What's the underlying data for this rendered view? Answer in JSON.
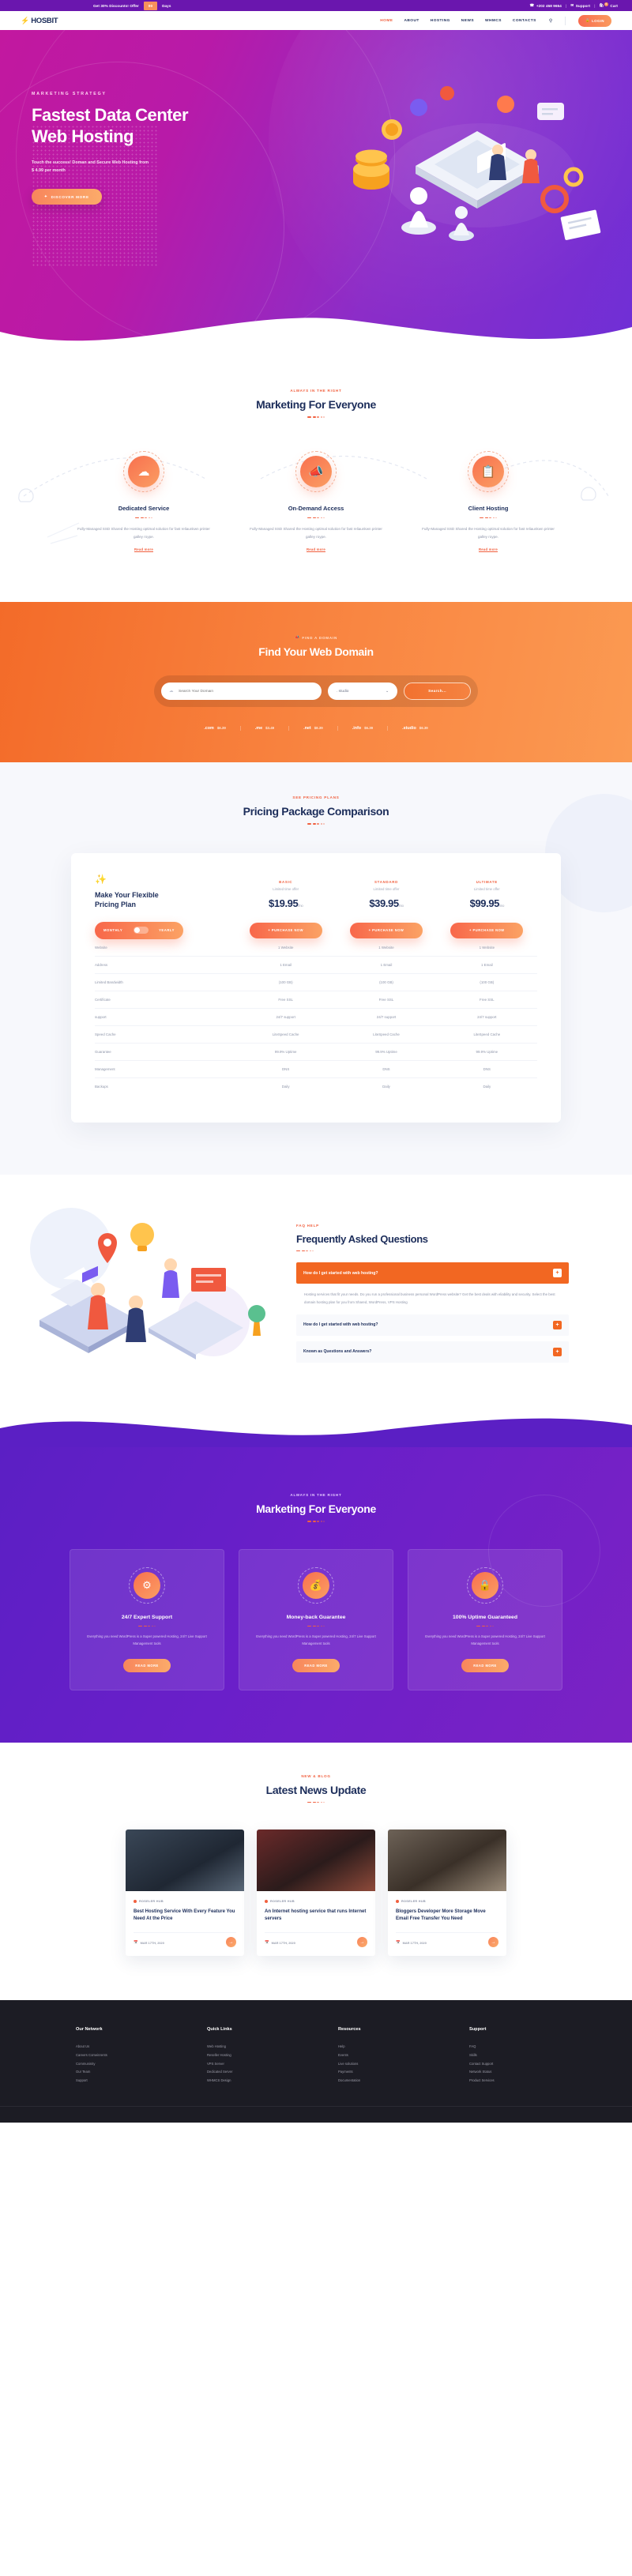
{
  "topbar": {
    "offer": "Get 30% Discounts! Offer",
    "count": "00",
    "days": "Days",
    "phone": "+202 458 9654",
    "support": "Support",
    "cart": "Cart",
    "cart_badge": "0",
    "phone_icon": "headset-icon",
    "support_icon": "envelope-icon",
    "cart_icon": "cart-icon"
  },
  "nav": {
    "logo_mark": "bolt-icon",
    "logo": "HOSBIT",
    "items": [
      {
        "label": "HOME",
        "active": true
      },
      {
        "label": "ABOUT",
        "active": false
      },
      {
        "label": "HOSTING",
        "active": false
      },
      {
        "label": "NEWS",
        "active": false
      },
      {
        "label": "WHMCS",
        "active": false
      },
      {
        "label": "CONTACTS",
        "active": false
      }
    ],
    "search_icon": "search-icon",
    "login": "LOGIN",
    "login_icon": "lock-icon"
  },
  "hero": {
    "kicker": "MARKETING STRATEGY",
    "title_line1": "Fastest Data Center",
    "title_line2": "Web Hosting",
    "sub_line1": "Touch the success! Doman and Secure Web Hosting from",
    "sub_line2": "$ 4.99 per month",
    "cta": "DISCOVER MORE",
    "cta_icon": "sparkle-icon"
  },
  "services": {
    "kicker": "ALWAYS IN THE RIGHT",
    "title": "Marketing For Everyone",
    "cards": [
      {
        "icon": "cloud-server-icon",
        "glyph": "☁",
        "title": "Dedicated Service",
        "text": "Fully-Managed SSD Shared the Hosting optimal solution for fast reliaunkwn printer galley roype.",
        "more": "Read more"
      },
      {
        "icon": "megaphone-icon",
        "glyph": "📢",
        "title": "On-Demand Access",
        "text": "Fully-Managed SSD Shared the Hosting optimal solution for fast reliaunkwn printer galley roype.",
        "more": "Read more"
      },
      {
        "icon": "clipboard-icon",
        "glyph": "📋",
        "title": "Client Hosting",
        "text": "Fully-Managed SSD Shared the Hosting optimal solution for fast reliaunkwn printer galley roype.",
        "more": "Read more"
      }
    ]
  },
  "domain": {
    "kicker": "FIND A DOMAIN",
    "kicker_icon": "megaphone-icon",
    "title": "Find Your Web Domain",
    "input_placeholder": "Search Your Domain",
    "input_icon": "globe-icon",
    "select_value": ". studio",
    "select_icon": "chevron-down-icon",
    "search_button": "Search...",
    "tlds": [
      {
        "name": ".com",
        "price": "$6.39"
      },
      {
        "name": ".me",
        "price": "$3.49"
      },
      {
        "name": ".net",
        "price": "$8.39"
      },
      {
        "name": ".info",
        "price": "$6.39"
      },
      {
        "name": ".studio",
        "price": "$6.39"
      }
    ]
  },
  "pricing": {
    "kicker": "SEE PRICING PLANS",
    "title": "Pricing Package Comparison",
    "heading_icon": "magic-wand-icon",
    "heading_line1": "Make Your Flexible",
    "heading_line2": "Pricing Plan",
    "toggle_left": "MONTHLY",
    "toggle_right": "YEARLY",
    "plans": [
      {
        "name": "BASIC",
        "offer": "Limited time offer",
        "price": "$19.95",
        "per": "/mo",
        "cta": "+ PURCHASE NOW"
      },
      {
        "name": "STANDARD",
        "offer": "Limited time offer",
        "price": "$39.95",
        "per": "/mo",
        "cta": "+ PURCHASE NOW"
      },
      {
        "name": "ULTIMATE",
        "offer": "Limited time offer",
        "price": "$99.95",
        "per": "/mo",
        "cta": "+ PURCHASE NOW"
      }
    ],
    "features": [
      {
        "label": "Website",
        "values": [
          "1 Website",
          "1 Website",
          "1 Website"
        ]
      },
      {
        "label": "Address",
        "values": [
          "1 Email",
          "1 Email",
          "1 Email"
        ]
      },
      {
        "label": "Limited Bandwidth",
        "values": [
          "(100 GB)",
          "(100 GB)",
          "(100 GB)"
        ]
      },
      {
        "label": "Certificate",
        "values": [
          "Free SSL",
          "Free SSL",
          "Free SSL"
        ]
      },
      {
        "label": "support",
        "values": [
          "24/7 support",
          "24/7 support",
          "24/7 support"
        ]
      },
      {
        "label": "Speed Cache",
        "values": [
          "LiteSpeed Cache",
          "LiteSpeed Cache",
          "LiteSpeed Cache"
        ]
      },
      {
        "label": "Guarantee",
        "values": [
          "99.9% Uptime",
          "99.9% Uptime",
          "99.9% Uptime"
        ]
      },
      {
        "label": "Management",
        "values": [
          "DNS",
          "DNS",
          "DNS"
        ]
      },
      {
        "label": "Backups",
        "values": [
          "Daily",
          "Daily",
          "Daily"
        ]
      }
    ]
  },
  "faq": {
    "kicker": "FAQ HELP",
    "title": "Frequently Asked Questions",
    "items": [
      {
        "question": "How do I get started with web hosting?",
        "open": true,
        "toggle": "+",
        "answer": "Hosting services that fit your needs. Do you run a professional business personal WordPress website? Get the best deals with eliability and security. Select the best domain hosting plan for you from Shared, WordPress, VPS Hosting"
      },
      {
        "question": "How do I get started with web hosting?",
        "open": false,
        "toggle": "+",
        "answer": ""
      },
      {
        "question": "Known as Questions and Answers?",
        "open": false,
        "toggle": "+",
        "answer": ""
      }
    ]
  },
  "features_purple": {
    "kicker": "ALWAYS IN THE RIGHT",
    "title": "Marketing For Everyone",
    "cards": [
      {
        "icon": "lifebuoy-icon",
        "glyph": "⚕",
        "title": "24/7 Expert Support",
        "text": "Everything you need WordPress is a Super powered Hosting, 24/7 Live Support Management tools",
        "cta": "READ MORE"
      },
      {
        "icon": "wallet-icon",
        "glyph": "💰",
        "title": "Money-back Guarantee",
        "text": "Everything you need WordPress is a Super powered Hosting, 24/7 Live Support Management tools",
        "cta": "READ MORE"
      },
      {
        "icon": "shield-icon",
        "glyph": "🔒",
        "title": "100% Uptime Guaranteed",
        "text": "Everything you need WordPress is a Super powered Hosting, 24/7 Live Support Management tools",
        "cta": "READ MORE"
      }
    ]
  },
  "blog": {
    "kicker": "NEW & BLOG",
    "title": "Latest News Update",
    "posts": [
      {
        "category": "ROSELER HUB",
        "title": "Best Hosting Service With Every Feature You Need At the Price",
        "date": "MAR 17TH, 2020",
        "date_icon": "calendar-icon",
        "arrow_icon": "arrow-right-icon"
      },
      {
        "category": "ROSELER HUB",
        "title": "An Internet hosting service that runs Internet servers",
        "date": "MAR 17TH, 2020",
        "date_icon": "calendar-icon",
        "arrow_icon": "arrow-right-icon"
      },
      {
        "category": "ROSELER HUB",
        "title": "Bloggers Developer More Storage Move Email Free Transfer You Need",
        "date": "MAR 17TH, 2020",
        "date_icon": "calendar-icon",
        "arrow_icon": "arrow-right-icon"
      }
    ]
  },
  "footer": {
    "columns": [
      {
        "head": "Our Network",
        "links": [
          "About Us",
          "Careers Comeinrents",
          "Communinity",
          "Our Team",
          "Support"
        ]
      },
      {
        "head": "Quick Links",
        "links": [
          "Web Hosting",
          "Reseller Hosting",
          "VPS Server",
          "Dedicated Server",
          "WHMCS Design"
        ]
      },
      {
        "head": "Resources",
        "links": [
          "Help",
          "Events",
          "Live solutions",
          "Payments",
          "Documentation"
        ]
      },
      {
        "head": "Support",
        "links": [
          "FAQ",
          "Skills",
          "Contact Support",
          "Network Status",
          "Product Services"
        ]
      }
    ]
  }
}
